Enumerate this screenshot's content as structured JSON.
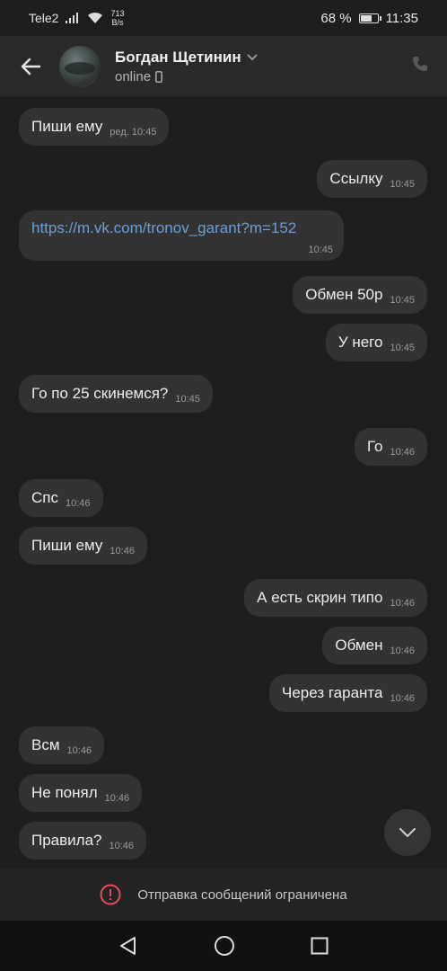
{
  "status_bar": {
    "carrier": "Tele2",
    "speed_value": "713",
    "speed_unit": "B/s",
    "battery_text": "68 %",
    "battery_level": 0.68,
    "time": "11:35"
  },
  "header": {
    "contact_name": "Богдан Щетинин",
    "status": "online"
  },
  "messages": [
    {
      "side": "left",
      "text": "Пиши ему",
      "time": "ред. 10:45"
    },
    {
      "side": "right",
      "text": "Ссылку",
      "time": "10:45"
    },
    {
      "side": "left",
      "text": "https://m.vk.com/tronov_garant?m=152",
      "time": "10:45",
      "is_link": true
    },
    {
      "side": "right",
      "text": "Обмен 50р",
      "time": "10:45"
    },
    {
      "side": "right",
      "text": "У него",
      "time": "10:45"
    },
    {
      "side": "left",
      "text": "Го по 25 скинемся?",
      "time": "10:45"
    },
    {
      "side": "right",
      "text": "Го",
      "time": "10:46"
    },
    {
      "side": "left",
      "text": "Спс",
      "time": "10:46"
    },
    {
      "side": "left",
      "text": "Пиши ему",
      "time": "10:46"
    },
    {
      "side": "right",
      "text": "А есть скрин типо",
      "time": "10:46"
    },
    {
      "side": "right",
      "text": "Обмен",
      "time": "10:46"
    },
    {
      "side": "right",
      "text": "Через гаранта",
      "time": "10:46"
    },
    {
      "side": "left",
      "text": "Всм",
      "time": "10:46"
    },
    {
      "side": "left",
      "text": "Не понял",
      "time": "10:46"
    },
    {
      "side": "left",
      "text": "Правила?",
      "time": "10:46"
    }
  ],
  "footer": {
    "restriction_text": "Отправка сообщений ограничена"
  },
  "colors": {
    "background": "#1e1e1e",
    "bubble": "#333333",
    "link": "#6d9fd6",
    "warning": "#e0505a"
  }
}
